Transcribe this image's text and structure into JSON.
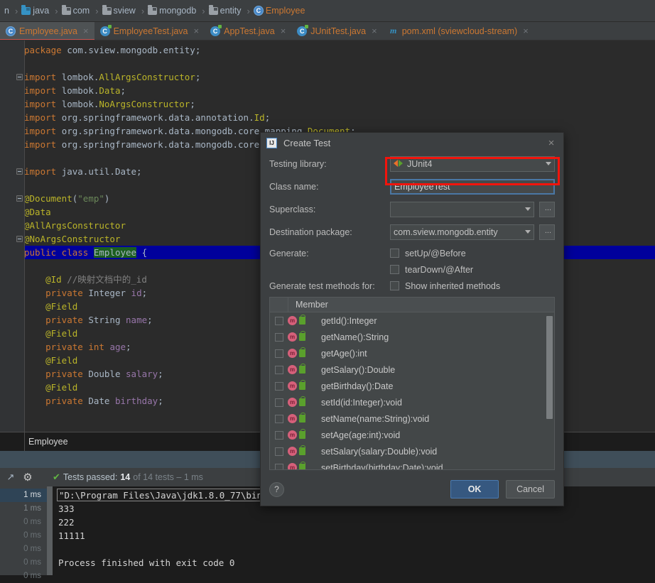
{
  "breadcrumb": {
    "items": [
      {
        "label": "n",
        "icon": "none"
      },
      {
        "label": "java",
        "icon": "folder-blue"
      },
      {
        "label": "com",
        "icon": "folder"
      },
      {
        "label": "sview",
        "icon": "folder"
      },
      {
        "label": "mongodb",
        "icon": "folder"
      },
      {
        "label": "entity",
        "icon": "folder"
      },
      {
        "label": "Employee",
        "icon": "class"
      }
    ]
  },
  "tabs": [
    {
      "label": "Employee.java",
      "icon": "class-icon",
      "active": true,
      "close": "×"
    },
    {
      "label": "EmployeeTest.java",
      "icon": "test-class-icon",
      "active": false,
      "close": "×"
    },
    {
      "label": "AppTest.java",
      "icon": "test-class-icon",
      "active": false,
      "close": "×"
    },
    {
      "label": "JUnitTest.java",
      "icon": "test-class-icon",
      "active": false,
      "close": "×"
    },
    {
      "label": "pom.xml (sviewcloud-stream)",
      "icon": "maven-icon",
      "active": false,
      "close": "×"
    }
  ],
  "editor": {
    "lines": [
      {
        "segs": [
          {
            "t": "package ",
            "c": "kw"
          },
          {
            "t": "com.sview.mongodb.entity;",
            "c": "typ"
          }
        ]
      },
      {
        "segs": []
      },
      {
        "segs": [
          {
            "t": "import ",
            "c": "kw"
          },
          {
            "t": "lombok.",
            "c": "typ"
          },
          {
            "t": "AllArgsConstructor",
            "c": "ann"
          },
          {
            "t": ";",
            "c": "typ"
          }
        ],
        "fold": "start"
      },
      {
        "segs": [
          {
            "t": "import ",
            "c": "kw"
          },
          {
            "t": "lombok.",
            "c": "typ"
          },
          {
            "t": "Data",
            "c": "ann"
          },
          {
            "t": ";",
            "c": "typ"
          }
        ]
      },
      {
        "segs": [
          {
            "t": "import ",
            "c": "kw"
          },
          {
            "t": "lombok.",
            "c": "typ"
          },
          {
            "t": "NoArgsConstructor",
            "c": "ann"
          },
          {
            "t": ";",
            "c": "typ"
          }
        ]
      },
      {
        "segs": [
          {
            "t": "import ",
            "c": "kw"
          },
          {
            "t": "org.springframework.data.annotation.",
            "c": "typ"
          },
          {
            "t": "Id",
            "c": "ann"
          },
          {
            "t": ";",
            "c": "typ"
          }
        ]
      },
      {
        "segs": [
          {
            "t": "import ",
            "c": "kw"
          },
          {
            "t": "org.springframework.data.mongodb.core.mapping.",
            "c": "typ"
          },
          {
            "t": "Document",
            "c": "ann"
          },
          {
            "t": ";",
            "c": "typ"
          }
        ]
      },
      {
        "segs": [
          {
            "t": "import ",
            "c": "kw"
          },
          {
            "t": "org.springframework.data.mongodb.core.mappi",
            "c": "typ"
          }
        ]
      },
      {
        "segs": []
      },
      {
        "segs": [
          {
            "t": "import ",
            "c": "kw"
          },
          {
            "t": "java.util.Date;",
            "c": "typ"
          }
        ],
        "fold": "end"
      },
      {
        "segs": []
      },
      {
        "segs": [
          {
            "t": "@Document",
            "c": "ann"
          },
          {
            "t": "(",
            "c": "typ"
          },
          {
            "t": "\"emp\"",
            "c": "str"
          },
          {
            "t": ")",
            "c": "typ"
          }
        ],
        "fold": "start"
      },
      {
        "segs": [
          {
            "t": "@Data",
            "c": "ann"
          }
        ]
      },
      {
        "segs": [
          {
            "t": "@AllArgsConstructor",
            "c": "ann"
          }
        ]
      },
      {
        "segs": [
          {
            "t": "@NoArgsConstructor",
            "c": "ann"
          }
        ],
        "fold": "end"
      },
      {
        "segs": [
          {
            "t": "public class ",
            "c": "kw"
          },
          {
            "t": "Employee",
            "c": "cls-hl"
          },
          {
            "t": " {",
            "c": "typ"
          }
        ],
        "sel": true
      },
      {
        "segs": []
      },
      {
        "segs": [
          {
            "t": "    @Id ",
            "c": "ann"
          },
          {
            "t": "//映射文档中的_id",
            "c": "cmt"
          }
        ]
      },
      {
        "segs": [
          {
            "t": "    ",
            "c": "typ"
          },
          {
            "t": "private ",
            "c": "kw"
          },
          {
            "t": "Integer ",
            "c": "typ"
          },
          {
            "t": "id",
            "c": "fld"
          },
          {
            "t": ";",
            "c": "typ"
          }
        ]
      },
      {
        "segs": [
          {
            "t": "    @Field",
            "c": "ann"
          }
        ]
      },
      {
        "segs": [
          {
            "t": "    ",
            "c": "typ"
          },
          {
            "t": "private ",
            "c": "kw"
          },
          {
            "t": "String ",
            "c": "typ"
          },
          {
            "t": "name",
            "c": "fld"
          },
          {
            "t": ";",
            "c": "typ"
          }
        ]
      },
      {
        "segs": [
          {
            "t": "    @Field",
            "c": "ann"
          }
        ]
      },
      {
        "segs": [
          {
            "t": "    ",
            "c": "typ"
          },
          {
            "t": "private ",
            "c": "kw"
          },
          {
            "t": "int ",
            "c": "kw"
          },
          {
            "t": "age",
            "c": "fld"
          },
          {
            "t": ";",
            "c": "typ"
          }
        ]
      },
      {
        "segs": [
          {
            "t": "    @Field",
            "c": "ann"
          }
        ]
      },
      {
        "segs": [
          {
            "t": "    ",
            "c": "typ"
          },
          {
            "t": "private ",
            "c": "kw"
          },
          {
            "t": "Double ",
            "c": "typ"
          },
          {
            "t": "salary",
            "c": "fld"
          },
          {
            "t": ";",
            "c": "typ"
          }
        ]
      },
      {
        "segs": [
          {
            "t": "    @Field",
            "c": "ann"
          }
        ]
      },
      {
        "segs": [
          {
            "t": "    ",
            "c": "typ"
          },
          {
            "t": "private ",
            "c": "kw"
          },
          {
            "t": "Date ",
            "c": "typ"
          },
          {
            "t": "birthday",
            "c": "fld"
          },
          {
            "t": ";",
            "c": "typ"
          }
        ]
      }
    ]
  },
  "status": {
    "label": "Employee"
  },
  "run": {
    "summary_check": "✔",
    "summary_prefix": "Tests passed:",
    "summary_count": "14",
    "summary_suffix": "of 14 tests – 1 ms",
    "times": [
      "1 ms",
      "1 ms",
      "0 ms",
      "0 ms",
      "0 ms",
      "0 ms",
      "0 ms"
    ],
    "console": [
      {
        "text": "\"D:\\Program Files\\Java\\jdk1.8.0_77\\bin\\java",
        "boxed": true
      },
      {
        "text": "333",
        "boxed": false
      },
      {
        "text": "222",
        "boxed": false
      },
      {
        "text": "11111",
        "boxed": false
      },
      {
        "text": "",
        "boxed": false
      },
      {
        "text": "Process finished with exit code 0",
        "boxed": false
      }
    ]
  },
  "dialog": {
    "title": "Create Test",
    "close_label": "×",
    "fields": {
      "testing_library_label": "Testing library:",
      "testing_library_value": "JUnit4",
      "class_name_label": "Class name:",
      "class_name_value": "EmployeeTest",
      "superclass_label": "Superclass:",
      "superclass_value": "",
      "destination_package_label": "Destination package:",
      "destination_package_value": "com.sview.mongodb.entity",
      "ellipsis_label": "...",
      "generate_label": "Generate:",
      "generate_options": [
        "setUp/@Before",
        "tearDown/@After"
      ],
      "generate_methods_label": "Generate test methods for:",
      "show_inherited_label": "Show inherited methods"
    },
    "member_header": "Member",
    "members": [
      "getId():Integer",
      "getName():String",
      "getAge():int",
      "getSalary():Double",
      "getBirthday():Date",
      "setId(id:Integer):void",
      "setName(name:String):void",
      "setAge(age:int):void",
      "setSalary(salary:Double):void",
      "setBirthday(birthday:Date):void"
    ],
    "help_label": "?",
    "ok_label": "OK",
    "cancel_label": "Cancel"
  },
  "colors": {
    "accent_blue": "#365880",
    "highlight_red": "#f2140c",
    "pass_green": "#62b543",
    "selection_blue": "#00009c"
  }
}
